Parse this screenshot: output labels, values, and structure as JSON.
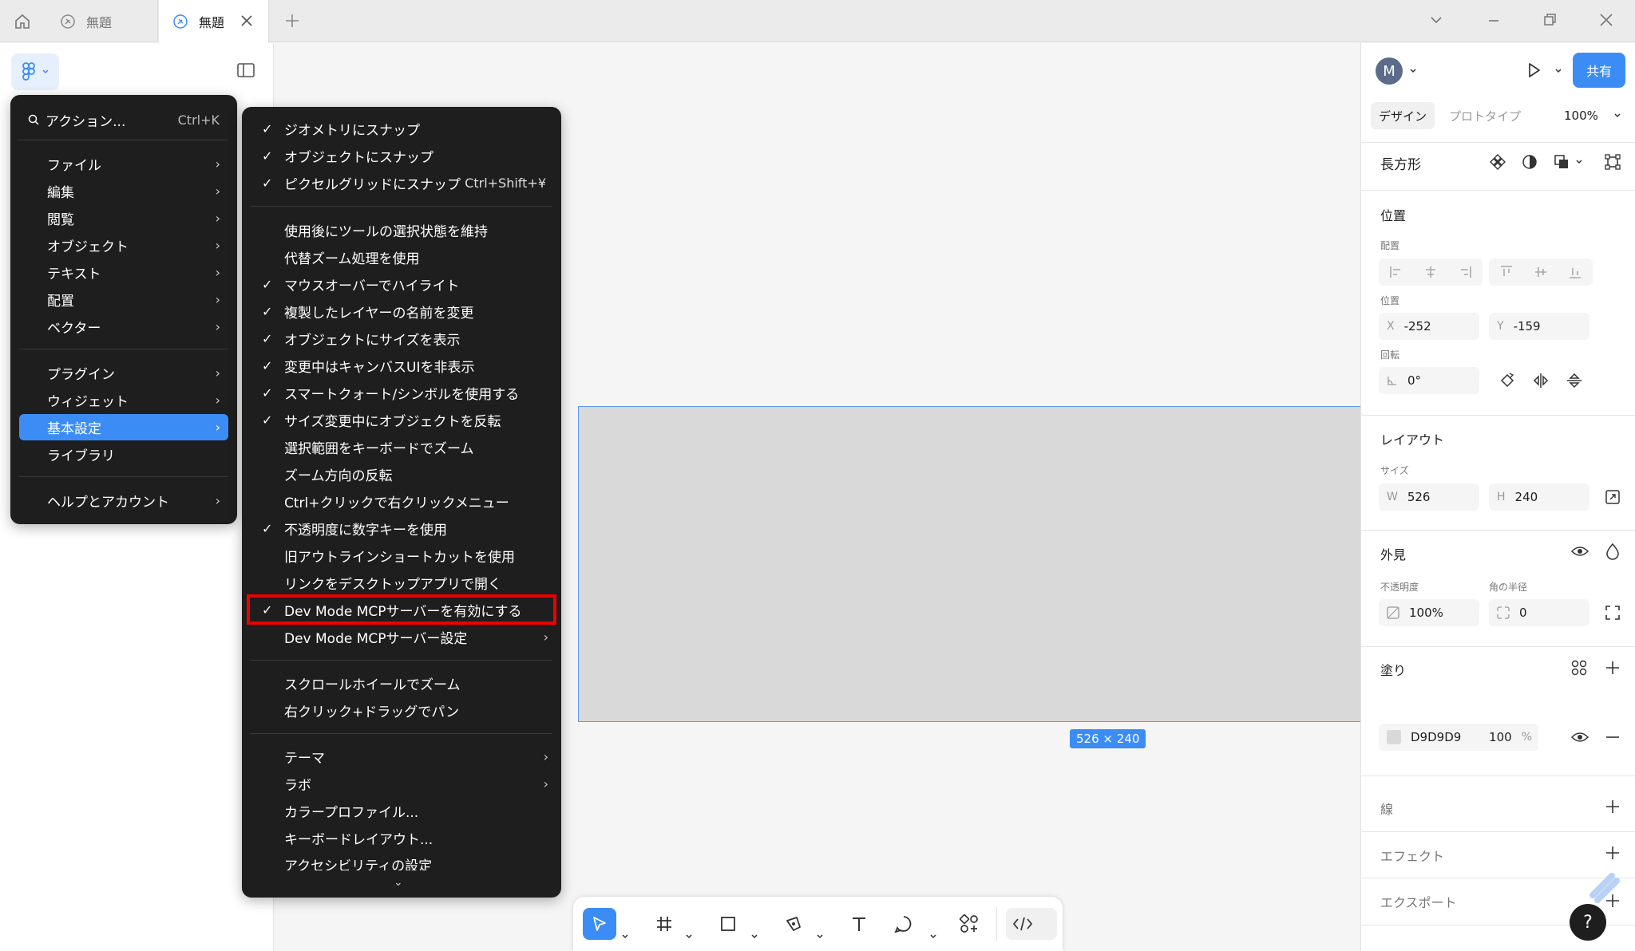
{
  "titlebar": {
    "tabs": [
      {
        "label": "無題"
      },
      {
        "label": "無題"
      }
    ]
  },
  "main_menu": {
    "search_label": "アクション...",
    "search_shortcut": "Ctrl+K",
    "items": [
      {
        "label": "ファイル",
        "chev": "›"
      },
      {
        "label": "編集",
        "chev": "›"
      },
      {
        "label": "閲覧",
        "chev": "›"
      },
      {
        "label": "オブジェクト",
        "chev": "›"
      },
      {
        "label": "テキスト",
        "chev": "›"
      },
      {
        "label": "配置",
        "chev": "›"
      },
      {
        "label": "ベクター",
        "chev": "›"
      },
      {
        "label": "プラグイン",
        "chev": "›"
      },
      {
        "label": "ウィジェット",
        "chev": "›"
      },
      {
        "label": "基本設定",
        "chev": "›"
      },
      {
        "label": "ライブラリ"
      },
      {
        "label": "ヘルプとアカウント",
        "chev": "›"
      }
    ]
  },
  "preferences_menu": {
    "items": [
      {
        "label": "ジオメトリにスナップ",
        "check": "✓"
      },
      {
        "label": "オブジェクトにスナップ",
        "check": "✓"
      },
      {
        "label": "ピクセルグリッドにスナップ",
        "check": "✓",
        "shortcut": "Ctrl+Shift+¥"
      },
      {
        "label": "使用後にツールの選択状態を維持"
      },
      {
        "label": "代替ズーム処理を使用"
      },
      {
        "label": "マウスオーバーでハイライト",
        "check": "✓"
      },
      {
        "label": "複製したレイヤーの名前を変更",
        "check": "✓"
      },
      {
        "label": "オブジェクトにサイズを表示",
        "check": "✓"
      },
      {
        "label": "変更中はキャンバスUIを非表示",
        "check": "✓"
      },
      {
        "label": "スマートクォート/シンボルを使用する",
        "check": "✓"
      },
      {
        "label": "サイズ変更中にオブジェクトを反転",
        "check": "✓"
      },
      {
        "label": "選択範囲をキーボードでズーム"
      },
      {
        "label": "ズーム方向の反転"
      },
      {
        "label": "Ctrl+クリックで右クリックメニュー"
      },
      {
        "label": "不透明度に数字キーを使用",
        "check": "✓"
      },
      {
        "label": "旧アウトラインショートカットを使用"
      },
      {
        "label": "リンクをデスクトップアプリで開く"
      },
      {
        "label": "Dev Mode MCPサーバーを有効にする",
        "check": "✓"
      },
      {
        "label": "Dev Mode MCPサーバー設定",
        "chev": "›"
      },
      {
        "label": "スクロールホイールでズーム"
      },
      {
        "label": "右クリック+ドラッグでパン"
      },
      {
        "label": "テーマ",
        "chev": "›"
      },
      {
        "label": "ラボ",
        "chev": "›"
      },
      {
        "label": "カラープロファイル..."
      },
      {
        "label": "キーボードレイアウト..."
      },
      {
        "label": "アクセシビリティの設定"
      }
    ]
  },
  "canvas": {
    "size_label": "526 × 240"
  },
  "right_panel": {
    "avatar_initial": "M",
    "share_label": "共有",
    "tab_design": "デザイン",
    "tab_prototype": "プロトタイプ",
    "zoom": "100%",
    "shape_title": "長方形",
    "position_title": "位置",
    "align_label": "配置",
    "position_label": "位置",
    "x_label": "X",
    "x_value": "-252",
    "y_label": "Y",
    "y_value": "-159",
    "rotation_label": "回転",
    "rotation_value": "0°",
    "layout_title": "レイアウト",
    "size_label": "サイズ",
    "w_label": "W",
    "w_value": "526",
    "h_label": "H",
    "h_value": "240",
    "appearance_title": "外見",
    "opacity_label": "不透明度",
    "opacity_value": "100%",
    "radius_label": "角の半径",
    "radius_value": "0",
    "fill_title": "塗り",
    "fill_hex": "D9D9D9",
    "fill_opacity": "100",
    "fill_pct": "%",
    "stroke_title": "線",
    "effects_title": "エフェクト",
    "export_title": "エクスポート"
  },
  "help_label": "?",
  "colors": {
    "accent": "#3b8df5",
    "menu_bg": "#1e1e1e",
    "fill": "#d9d9d9",
    "highlight_box": "#e00000"
  }
}
